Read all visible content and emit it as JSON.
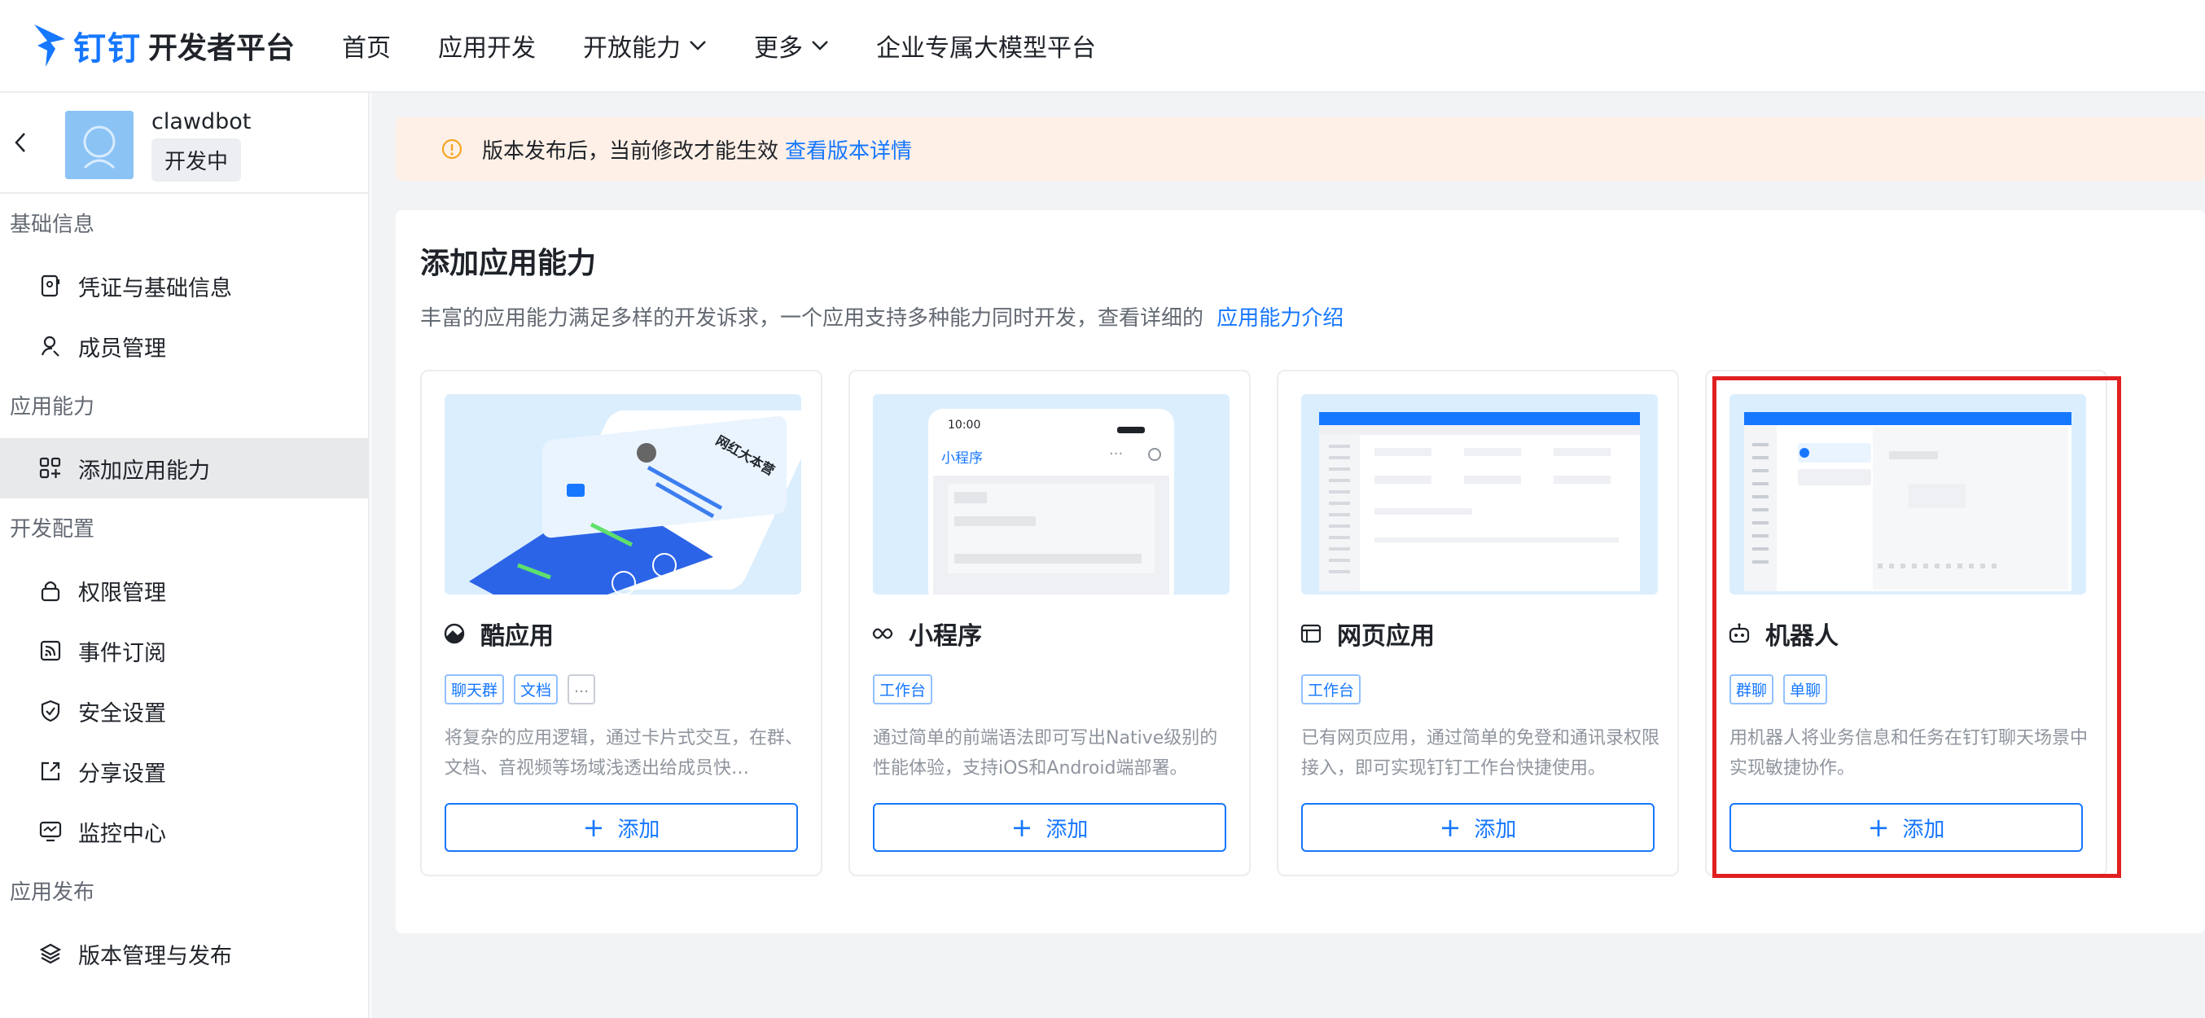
{
  "brand": {
    "name": "钉钉",
    "subtitle": "开发者平台"
  },
  "nav": {
    "items": [
      {
        "label": "首页",
        "dropdown": false
      },
      {
        "label": "应用开发",
        "dropdown": false
      },
      {
        "label": "开放能力",
        "dropdown": true
      },
      {
        "label": "更多",
        "dropdown": true
      },
      {
        "label": "企业专属大模型平台",
        "dropdown": false
      }
    ]
  },
  "app": {
    "name": "clawdbot",
    "status": "开发中"
  },
  "sidebar": {
    "sections": [
      {
        "title": "基础信息",
        "items": [
          {
            "label": "凭证与基础信息",
            "icon": "credential-icon"
          },
          {
            "label": "成员管理",
            "icon": "user-icon"
          }
        ]
      },
      {
        "title": "应用能力",
        "items": [
          {
            "label": "添加应用能力",
            "icon": "grid-add-icon",
            "active": true
          }
        ]
      },
      {
        "title": "开发配置",
        "items": [
          {
            "label": "权限管理",
            "icon": "lock-icon"
          },
          {
            "label": "事件订阅",
            "icon": "rss-icon"
          },
          {
            "label": "安全设置",
            "icon": "shield-icon"
          },
          {
            "label": "分享设置",
            "icon": "share-icon"
          },
          {
            "label": "监控中心",
            "icon": "monitor-icon"
          }
        ]
      },
      {
        "title": "应用发布",
        "items": [
          {
            "label": "版本管理与发布",
            "icon": "layers-icon"
          }
        ]
      }
    ]
  },
  "notice": {
    "text": "版本发布后，当前修改才能生效",
    "link": "查看版本详情"
  },
  "panel": {
    "title": "添加应用能力",
    "desc": "丰富的应用能力满足多样的开发诉求，一个应用支持多种能力同时开发，查看详细的",
    "desc_link": "应用能力介绍"
  },
  "cards": [
    {
      "title": "酷应用",
      "icon": "cool-app-icon",
      "tags": [
        "聊天群",
        "文档",
        "..."
      ],
      "desc": "将复杂的应用逻辑，通过卡片式交互，在群、文档、音视频等场域浅透出给成员快…",
      "button": "添加",
      "preview_text": "网红大本营"
    },
    {
      "title": "小程序",
      "icon": "infinity-icon",
      "tags": [
        "工作台"
      ],
      "desc": "通过简单的前端语法即可写出Native级别的性能体验，支持iOS和Android端部署。",
      "button": "添加",
      "preview_time": "10:00",
      "preview_title": "小程序"
    },
    {
      "title": "网页应用",
      "icon": "webpage-icon",
      "tags": [
        "工作台"
      ],
      "desc": "已有网页应用，通过简单的免登和通讯录权限接入，即可实现钉钉工作台快捷使用。",
      "button": "添加"
    },
    {
      "title": "机器人",
      "icon": "robot-icon",
      "tags": [
        "群聊",
        "单聊"
      ],
      "desc": "用机器人将业务信息和任务在钉钉聊天场景中实现敏捷协作。",
      "button": "添加"
    }
  ],
  "colors": {
    "accent": "#1677ff",
    "highlight": "#e02020",
    "notice_bg": "#fef0e6"
  }
}
